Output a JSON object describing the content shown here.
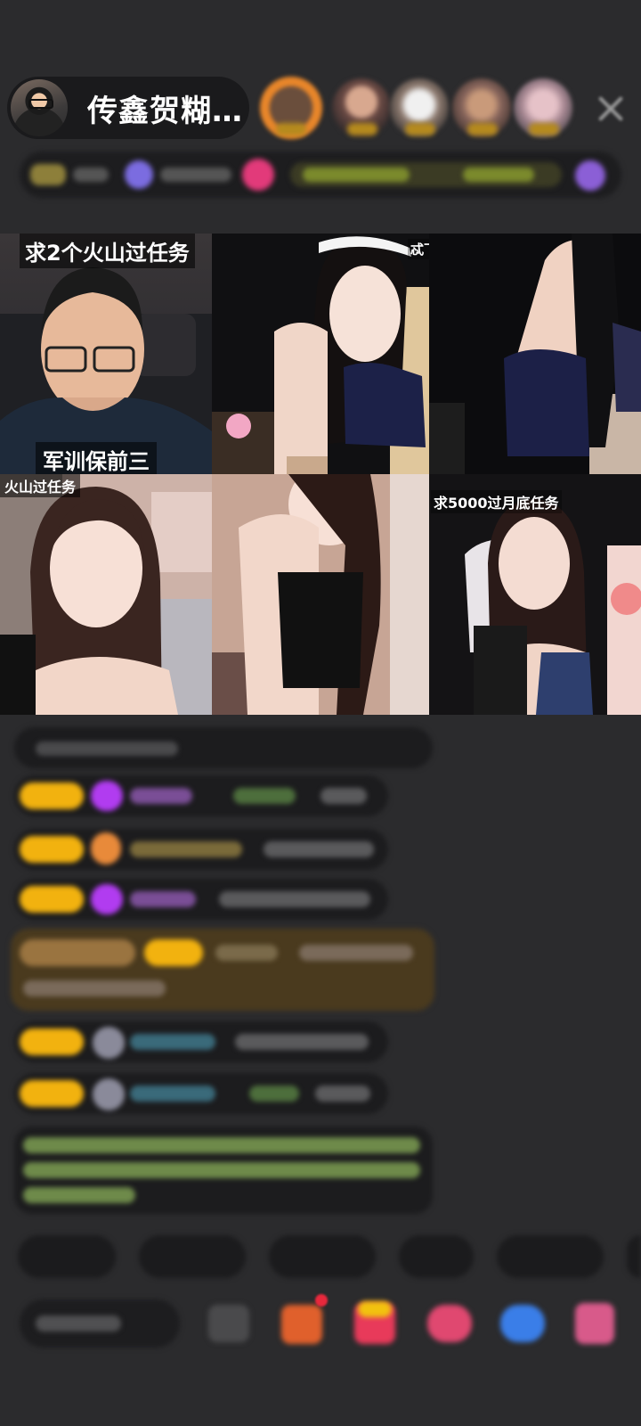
{
  "host": {
    "name": "传鑫贺糊…"
  },
  "tiles": [
    {
      "caption": "求2个火山过任务",
      "sub_caption": "军训保前三"
    },
    {
      "caption": "忒下"
    },
    {
      "caption": ""
    },
    {
      "caption": "火山过任务"
    },
    {
      "caption": ""
    },
    {
      "caption": "求5000过月底任务"
    }
  ],
  "colors": {
    "background": "#2b2b2d",
    "pill": "#1a1a1c",
    "badge_gold": "#f2b20f",
    "gift_orange": "#e8862a",
    "purple_gem": "#b13cf0",
    "chat_green": "#9be06b"
  },
  "icons": [
    "close-icon",
    "gem-icon",
    "gift-icon",
    "chat-icon",
    "mic-icon"
  ]
}
